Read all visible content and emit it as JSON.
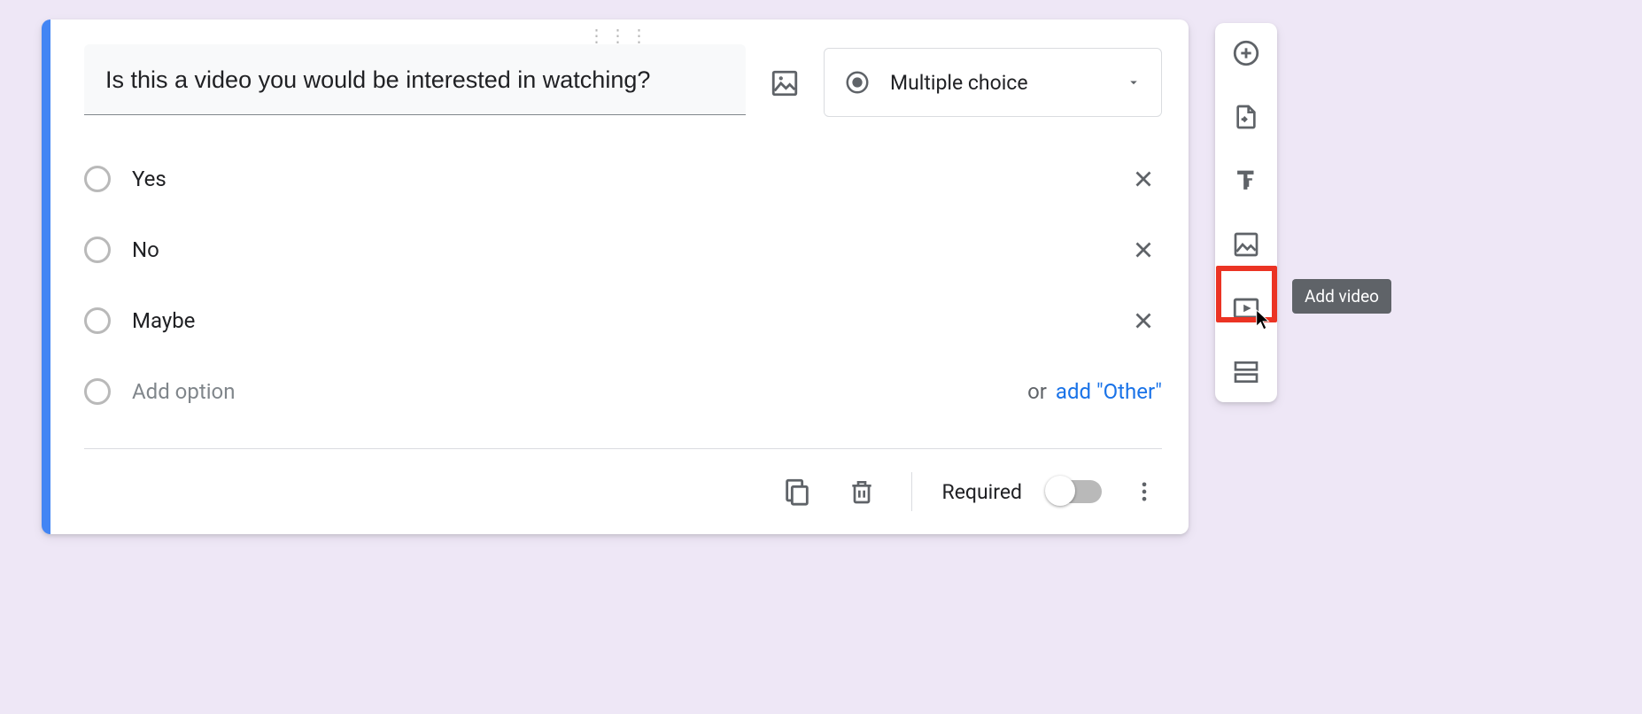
{
  "question": {
    "title": "Is this a video you would be interested in watching?",
    "type_label": "Multiple choice",
    "options": [
      {
        "label": "Yes"
      },
      {
        "label": "No"
      },
      {
        "label": "Maybe"
      }
    ],
    "add_option_text": "Add option",
    "or_text": "or",
    "add_other_text": "add \"Other\"",
    "required_label": "Required",
    "required_value": false
  },
  "side_toolbar": {
    "items": [
      {
        "name": "add-question",
        "tooltip": "Add question"
      },
      {
        "name": "import-questions",
        "tooltip": "Import questions"
      },
      {
        "name": "add-title",
        "tooltip": "Add title and description"
      },
      {
        "name": "add-image",
        "tooltip": "Add image"
      },
      {
        "name": "add-video",
        "tooltip": "Add video"
      },
      {
        "name": "add-section",
        "tooltip": "Add section"
      }
    ],
    "active_tooltip": "Add video"
  }
}
